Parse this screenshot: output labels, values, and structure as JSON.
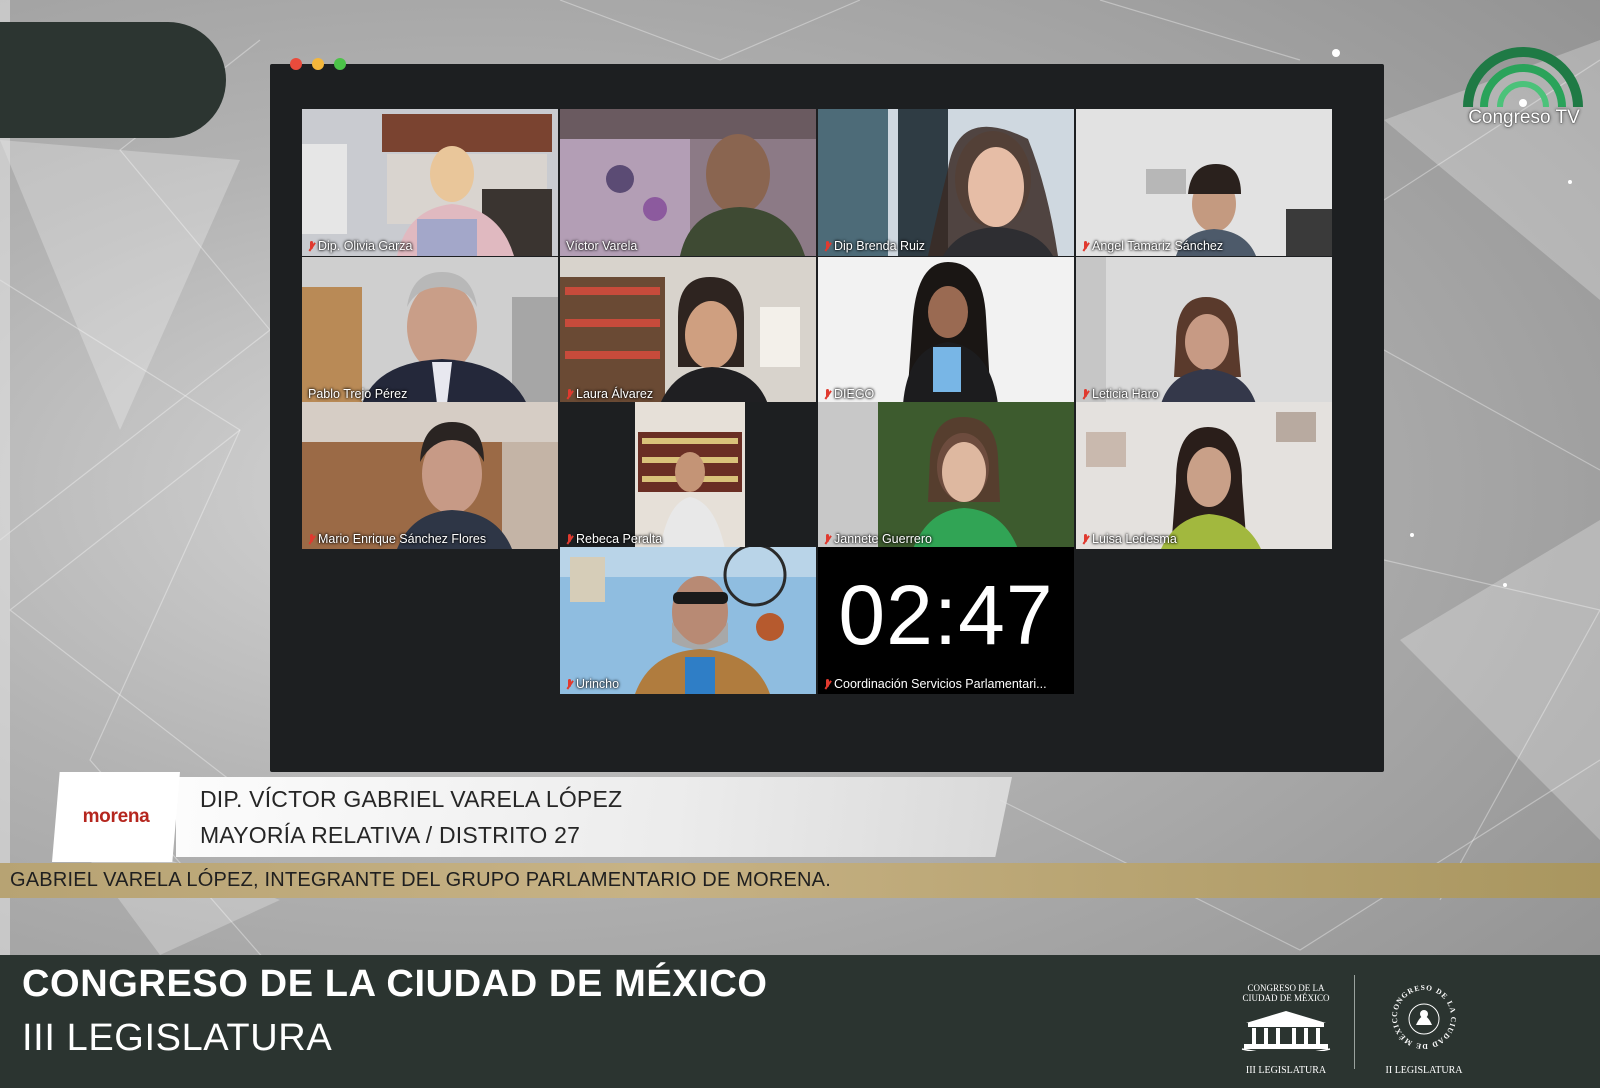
{
  "channel": {
    "name": "Congreso TV"
  },
  "meeting": {
    "participants": [
      {
        "name": "Dip. Olivia Garza",
        "muted": true
      },
      {
        "name": "Víctor Varela",
        "muted": false,
        "speaking": true
      },
      {
        "name": "Dip Brenda Ruiz",
        "muted": true
      },
      {
        "name": "Angel Tamariz Sánchez",
        "muted": true
      },
      {
        "name": "Pablo Trejo Pérez",
        "muted": false
      },
      {
        "name": "Laura Álvarez",
        "muted": true
      },
      {
        "name": "DIEGO",
        "muted": true
      },
      {
        "name": "Leticia Haro",
        "muted": true
      },
      {
        "name": "Mario Enrique Sánchez Flores",
        "muted": true
      },
      {
        "name": "Rebeca Peralta",
        "muted": true
      },
      {
        "name": "Jannete Guerrero",
        "muted": true
      },
      {
        "name": "Luisa Ledesma",
        "muted": true
      },
      {
        "name": "Urincho",
        "muted": true
      },
      {
        "name": "Coordinación Servicios Parlamentari...",
        "muted": true
      }
    ],
    "timer": "02:47"
  },
  "lower_third": {
    "party": "morena",
    "speaker": "DIP. VÍCTOR GABRIEL VARELA LÓPEZ",
    "district": "MAYORÍA RELATIVA / DISTRITO 27"
  },
  "ticker": {
    "text": "GABRIEL VARELA LÓPEZ, INTEGRANTE DEL GRUPO PARLAMENTARIO DE MORENA."
  },
  "footer": {
    "title": "CONGRESO DE LA CIUDAD DE MÉXICO",
    "subtitle": "III LEGISLATURA",
    "seal_left": {
      "top_line1": "CONGRESO DE LA",
      "top_line2": "CIUDAD DE MÉXICO",
      "bottom": "III LEGISLATURA"
    },
    "seal_right": {
      "ring_text": "CONGRESO DE LA CIUDAD DE MÉXICO",
      "bottom": "II LEGISLATURA"
    }
  },
  "colors": {
    "footer_bg": "#2b3430",
    "window_bg": "#1d1f21",
    "speaking_outline": "#3fae49",
    "muted_icon": "#e03a2f",
    "ticker_gold": "#b7a373",
    "party_red": "#b5261e"
  }
}
